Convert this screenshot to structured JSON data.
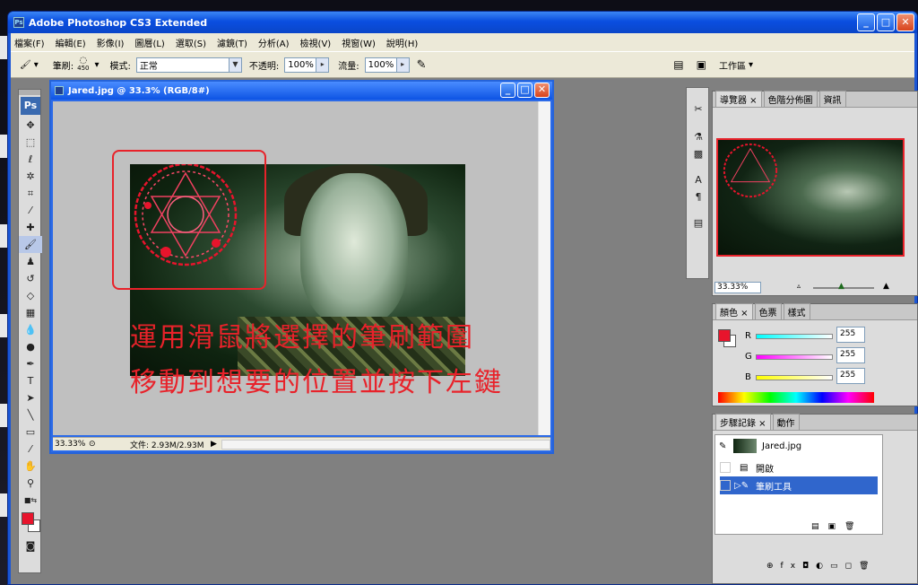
{
  "app": {
    "title": "Adobe Photoshop CS3 Extended"
  },
  "menu": [
    "檔案(F)",
    "編輯(E)",
    "影像(I)",
    "圖層(L)",
    "選取(S)",
    "濾鏡(T)",
    "分析(A)",
    "檢視(V)",
    "視窗(W)",
    "說明(H)"
  ],
  "options": {
    "brush_label": "筆刷:",
    "brush_size": "450",
    "mode_label": "模式:",
    "mode_value": "正常",
    "opacity_label": "不透明:",
    "opacity_value": "100%",
    "flow_label": "流量:",
    "flow_value": "100%",
    "workspace_label": "工作區"
  },
  "toolbox": {
    "logo": "Ps"
  },
  "document": {
    "title": "Jared.jpg @ 33.3% (RGB/8#)",
    "zoom": "33.33%",
    "file_info": "文件: 2.93M/2.93M"
  },
  "annotation": {
    "line1": "運用滑鼠將選擇的筆刷範圍",
    "line2": "移動到想要的位置並按下左鍵"
  },
  "navigator": {
    "tabs": [
      "導覽器",
      "色階分佈圖",
      "資訊"
    ],
    "zoom": "33.33%"
  },
  "color": {
    "tabs": [
      "顏色",
      "色票",
      "樣式"
    ],
    "r": "255",
    "g": "255",
    "b": "255",
    "r_label": "R",
    "g_label": "G",
    "b_label": "B",
    "foreground": "#e8142c"
  },
  "history": {
    "tabs": [
      "步驟記錄",
      "動作"
    ],
    "snapshot": "Jared.jpg",
    "steps": [
      "開啟",
      "筆刷工具"
    ]
  },
  "colors": {
    "title": "#0a4ee0",
    "accent": "#e8222a"
  }
}
